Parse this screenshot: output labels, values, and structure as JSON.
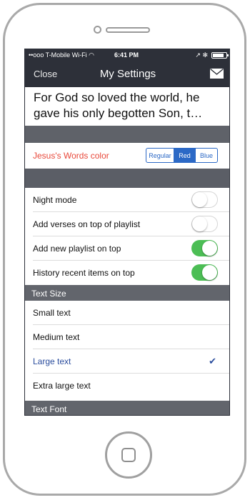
{
  "status_bar": {
    "carrier": "••ooo T-Mobile Wi-Fi ◠",
    "time": "6:41 PM",
    "indicators": "↗ ✻"
  },
  "nav": {
    "close_label": "Close",
    "title": "My Settings",
    "mail_icon": "envelope-icon"
  },
  "verse": {
    "line1": "For God so loved the world, he",
    "line2": "gave his only begotten Son, t…"
  },
  "words_color": {
    "label": "Jesus's Words color",
    "options": [
      "Regular",
      "Red",
      "Blue"
    ],
    "selected": "Red"
  },
  "toggles": [
    {
      "label": "Night mode",
      "on": false
    },
    {
      "label": "Add verses on top of playlist",
      "on": false
    },
    {
      "label": "Add new playlist on top",
      "on": true
    },
    {
      "label": "History recent items on top",
      "on": true
    }
  ],
  "text_size": {
    "header": "Text Size",
    "options": [
      "Small text",
      "Medium text",
      "Large text",
      "Extra large text"
    ],
    "selected": "Large text"
  },
  "text_font": {
    "header": "Text Font"
  },
  "colors": {
    "bar": "#2d3039",
    "accent_red": "#e8483a",
    "accent_blue": "#2c69c6",
    "toggle_on": "#4cbe55",
    "selected_text": "#2c4e9e"
  }
}
